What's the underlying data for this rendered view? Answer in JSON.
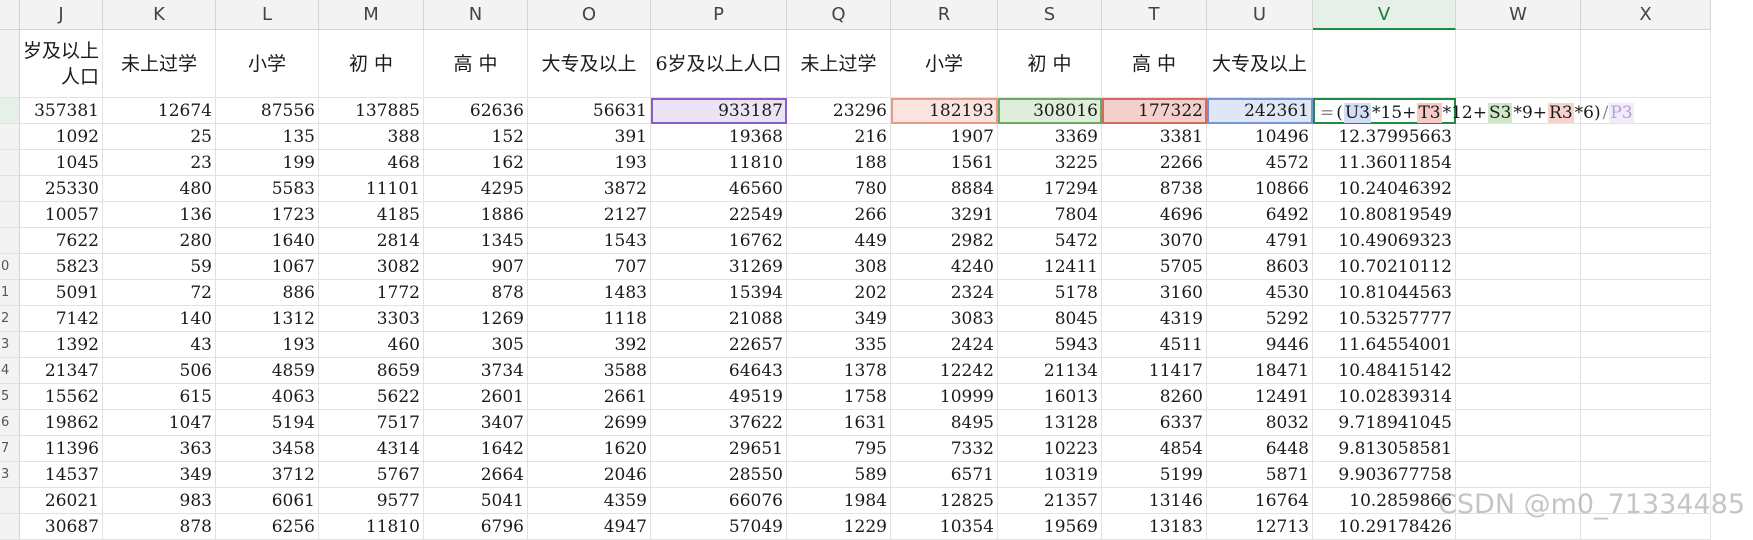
{
  "columns": [
    "J",
    "K",
    "L",
    "M",
    "N",
    "O",
    "P",
    "Q",
    "R",
    "S",
    "T",
    "U",
    "V",
    "W",
    "X"
  ],
  "selected_column": "V",
  "header_row": [
    "岁及以上人口",
    "未上过学",
    "小学",
    "初 中",
    "高 中",
    "大专及以上",
    "6岁及以上人口",
    "未上过学",
    "小学",
    "初 中",
    "高 中",
    "大专及以上",
    "",
    "",
    ""
  ],
  "row_labels": [
    "",
    "",
    "",
    "",
    "",
    "",
    "",
    "0",
    "1",
    "2",
    "3",
    "4",
    "5",
    "6",
    "7",
    "3",
    ""
  ],
  "rows": [
    [
      "357381",
      "12674",
      "87556",
      "137885",
      "62636",
      "56631",
      "933187",
      "23296",
      "182193",
      "308016",
      "177322",
      "242361",
      "",
      "",
      ""
    ],
    [
      "1092",
      "25",
      "135",
      "388",
      "152",
      "391",
      "19368",
      "216",
      "1907",
      "3369",
      "3381",
      "10496",
      "12.37995663",
      "",
      ""
    ],
    [
      "1045",
      "23",
      "199",
      "468",
      "162",
      "193",
      "11810",
      "188",
      "1561",
      "3225",
      "2266",
      "4572",
      "11.36011854",
      "",
      ""
    ],
    [
      "25330",
      "480",
      "5583",
      "11101",
      "4295",
      "3872",
      "46560",
      "780",
      "8884",
      "17294",
      "8738",
      "10866",
      "10.24046392",
      "",
      ""
    ],
    [
      "10057",
      "136",
      "1723",
      "4185",
      "1886",
      "2127",
      "22549",
      "266",
      "3291",
      "7804",
      "4696",
      "6492",
      "10.80819549",
      "",
      ""
    ],
    [
      "7622",
      "280",
      "1640",
      "2814",
      "1345",
      "1543",
      "16762",
      "449",
      "2982",
      "5472",
      "3070",
      "4791",
      "10.49069323",
      "",
      ""
    ],
    [
      "5823",
      "59",
      "1067",
      "3082",
      "907",
      "707",
      "31269",
      "308",
      "4240",
      "12411",
      "5705",
      "8603",
      "10.70210112",
      "",
      ""
    ],
    [
      "5091",
      "72",
      "886",
      "1772",
      "878",
      "1483",
      "15394",
      "202",
      "2324",
      "5178",
      "3160",
      "4530",
      "10.81044563",
      "",
      ""
    ],
    [
      "7142",
      "140",
      "1312",
      "3303",
      "1269",
      "1118",
      "21088",
      "349",
      "3083",
      "8045",
      "4319",
      "5292",
      "10.53257777",
      "",
      ""
    ],
    [
      "1392",
      "43",
      "193",
      "460",
      "305",
      "392",
      "22657",
      "335",
      "2424",
      "5943",
      "4511",
      "9446",
      "11.64554001",
      "",
      ""
    ],
    [
      "21347",
      "506",
      "4859",
      "8659",
      "3734",
      "3588",
      "64643",
      "1378",
      "12242",
      "21134",
      "11417",
      "18471",
      "10.48415142",
      "",
      ""
    ],
    [
      "15562",
      "615",
      "4063",
      "5622",
      "2601",
      "2661",
      "49519",
      "1758",
      "10999",
      "16013",
      "8260",
      "12491",
      "10.02839314",
      "",
      ""
    ],
    [
      "19862",
      "1047",
      "5194",
      "7517",
      "3407",
      "2699",
      "37622",
      "1631",
      "8495",
      "13128",
      "6337",
      "8032",
      "9.718941045",
      "",
      ""
    ],
    [
      "11396",
      "363",
      "3458",
      "4314",
      "1642",
      "1620",
      "29651",
      "795",
      "7332",
      "10223",
      "4854",
      "6448",
      "9.813058581",
      "",
      ""
    ],
    [
      "14537",
      "349",
      "3712",
      "5767",
      "2664",
      "2046",
      "28550",
      "589",
      "6571",
      "10319",
      "5199",
      "5871",
      "9.903677758",
      "",
      ""
    ],
    [
      "26021",
      "983",
      "6061",
      "9577",
      "5041",
      "4359",
      "66076",
      "1984",
      "12825",
      "21357",
      "13146",
      "16764",
      "10.2859866",
      "",
      ""
    ],
    [
      "30687",
      "878",
      "6256",
      "11810",
      "6796",
      "4947",
      "57049",
      "1229",
      "10354",
      "19569",
      "13183",
      "12713",
      "10.29178426",
      "",
      ""
    ]
  ],
  "formula": {
    "eq": "=",
    "open": "(",
    "u": "U3",
    "m15": "*15+",
    "t": "T3",
    "m12": "*12+",
    "s": "S3",
    "m9": "*9+",
    "r": "R3",
    "m6": "*6)",
    "div": "/",
    "p": "P3"
  },
  "reference_highlights": {
    "P": "purple",
    "R": "red",
    "S": "green",
    "T": "rose",
    "U": "blue"
  },
  "colors": {
    "selection": "#1e8a45",
    "ref_purple": "#8a5cc8",
    "ref_blue": "#7a93d6",
    "ref_green": "#6ea865",
    "ref_rose": "#d46a64",
    "ref_red": "#e59b8c"
  },
  "watermark": "CSDN @m0_71334485"
}
